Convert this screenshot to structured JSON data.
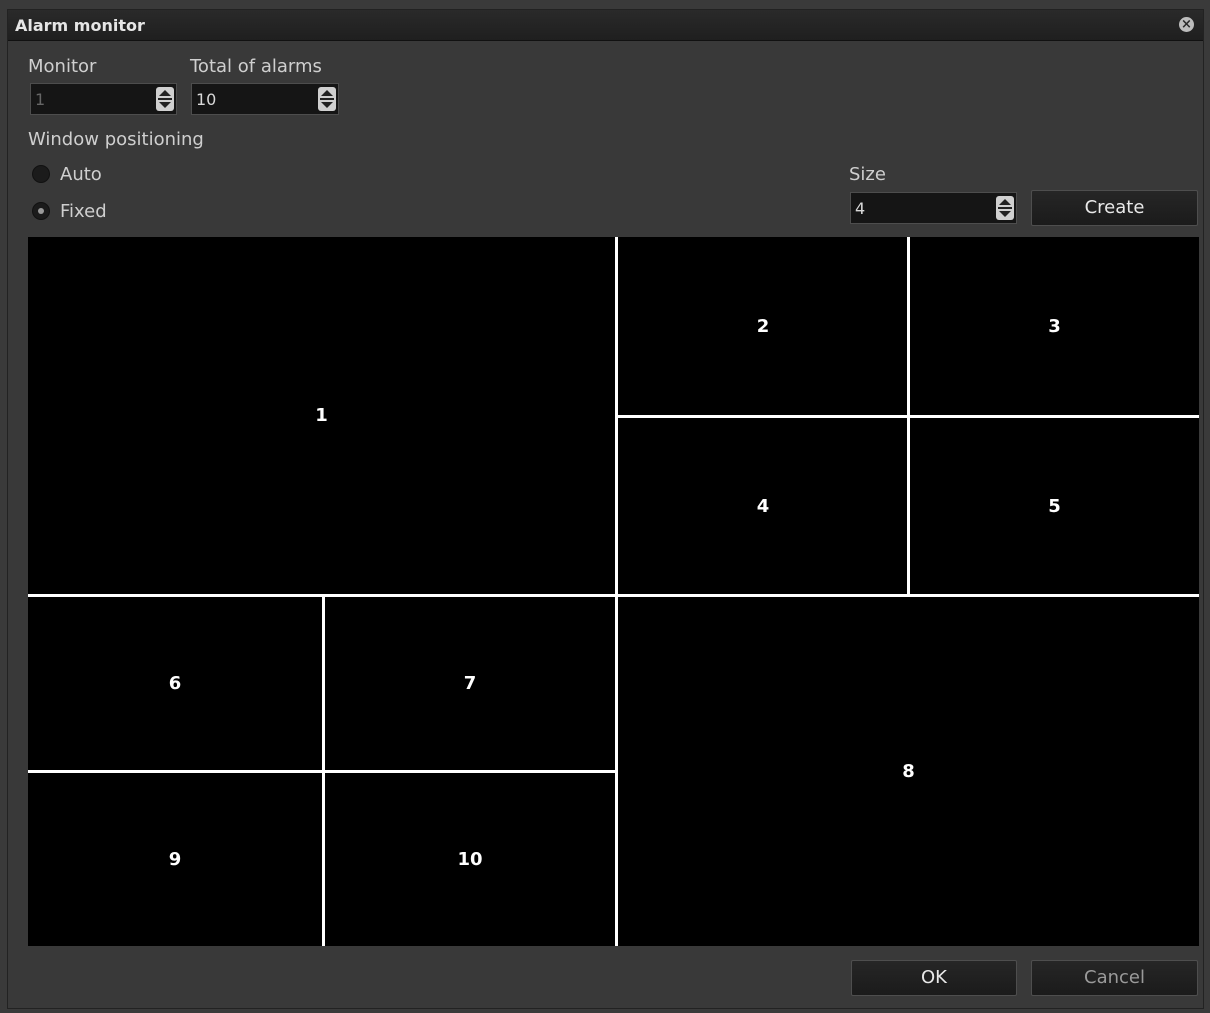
{
  "window": {
    "title": "Alarm monitor",
    "close_icon": "close-icon"
  },
  "monitor": {
    "label": "Monitor",
    "value": "1"
  },
  "total_alarms": {
    "label": "Total of alarms",
    "value": "10"
  },
  "positioning": {
    "label": "Window positioning",
    "options": [
      {
        "label": "Auto",
        "checked": false
      },
      {
        "label": "Fixed",
        "checked": true
      }
    ]
  },
  "size": {
    "label": "Size",
    "value": "4"
  },
  "buttons": {
    "create": "Create",
    "ok": "OK",
    "cancel": "Cancel"
  },
  "layout_cells": [
    "1",
    "2",
    "3",
    "4",
    "5",
    "6",
    "7",
    "8",
    "9",
    "10"
  ],
  "colors": {
    "background": "#393939",
    "titlebar": "#1f1f1f",
    "grid_background": "#000000",
    "grid_lines": "#ffffff"
  }
}
